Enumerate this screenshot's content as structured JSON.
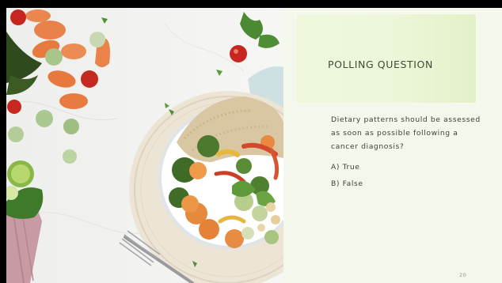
{
  "slide": {
    "title": "POLLING QUESTION",
    "question": "Dietary patterns should be assessed as soon as possible following a cancer diagnosis?",
    "options": [
      {
        "label": "A) True"
      },
      {
        "label": "B) False"
      }
    ],
    "page_number": "20"
  }
}
